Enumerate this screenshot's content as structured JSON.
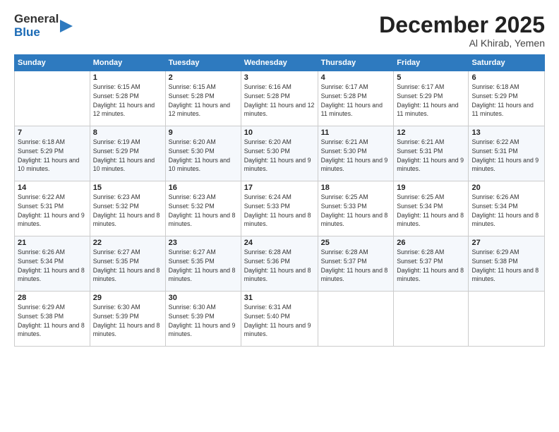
{
  "logo": {
    "general": "General",
    "blue": "Blue"
  },
  "header": {
    "month": "December 2025",
    "location": "Al Khirab, Yemen"
  },
  "weekdays": [
    "Sunday",
    "Monday",
    "Tuesday",
    "Wednesday",
    "Thursday",
    "Friday",
    "Saturday"
  ],
  "weeks": [
    [
      {
        "day": "",
        "info": ""
      },
      {
        "day": "1",
        "info": "Sunrise: 6:15 AM\nSunset: 5:28 PM\nDaylight: 11 hours and 12 minutes."
      },
      {
        "day": "2",
        "info": "Sunrise: 6:15 AM\nSunset: 5:28 PM\nDaylight: 11 hours and 12 minutes."
      },
      {
        "day": "3",
        "info": "Sunrise: 6:16 AM\nSunset: 5:28 PM\nDaylight: 11 hours and 12 minutes."
      },
      {
        "day": "4",
        "info": "Sunrise: 6:17 AM\nSunset: 5:28 PM\nDaylight: 11 hours and 11 minutes."
      },
      {
        "day": "5",
        "info": "Sunrise: 6:17 AM\nSunset: 5:29 PM\nDaylight: 11 hours and 11 minutes."
      },
      {
        "day": "6",
        "info": "Sunrise: 6:18 AM\nSunset: 5:29 PM\nDaylight: 11 hours and 11 minutes."
      }
    ],
    [
      {
        "day": "7",
        "info": "Sunrise: 6:18 AM\nSunset: 5:29 PM\nDaylight: 11 hours and 10 minutes."
      },
      {
        "day": "8",
        "info": "Sunrise: 6:19 AM\nSunset: 5:29 PM\nDaylight: 11 hours and 10 minutes."
      },
      {
        "day": "9",
        "info": "Sunrise: 6:20 AM\nSunset: 5:30 PM\nDaylight: 11 hours and 10 minutes."
      },
      {
        "day": "10",
        "info": "Sunrise: 6:20 AM\nSunset: 5:30 PM\nDaylight: 11 hours and 9 minutes."
      },
      {
        "day": "11",
        "info": "Sunrise: 6:21 AM\nSunset: 5:30 PM\nDaylight: 11 hours and 9 minutes."
      },
      {
        "day": "12",
        "info": "Sunrise: 6:21 AM\nSunset: 5:31 PM\nDaylight: 11 hours and 9 minutes."
      },
      {
        "day": "13",
        "info": "Sunrise: 6:22 AM\nSunset: 5:31 PM\nDaylight: 11 hours and 9 minutes."
      }
    ],
    [
      {
        "day": "14",
        "info": "Sunrise: 6:22 AM\nSunset: 5:31 PM\nDaylight: 11 hours and 9 minutes."
      },
      {
        "day": "15",
        "info": "Sunrise: 6:23 AM\nSunset: 5:32 PM\nDaylight: 11 hours and 8 minutes."
      },
      {
        "day": "16",
        "info": "Sunrise: 6:23 AM\nSunset: 5:32 PM\nDaylight: 11 hours and 8 minutes."
      },
      {
        "day": "17",
        "info": "Sunrise: 6:24 AM\nSunset: 5:33 PM\nDaylight: 11 hours and 8 minutes."
      },
      {
        "day": "18",
        "info": "Sunrise: 6:25 AM\nSunset: 5:33 PM\nDaylight: 11 hours and 8 minutes."
      },
      {
        "day": "19",
        "info": "Sunrise: 6:25 AM\nSunset: 5:34 PM\nDaylight: 11 hours and 8 minutes."
      },
      {
        "day": "20",
        "info": "Sunrise: 6:26 AM\nSunset: 5:34 PM\nDaylight: 11 hours and 8 minutes."
      }
    ],
    [
      {
        "day": "21",
        "info": "Sunrise: 6:26 AM\nSunset: 5:34 PM\nDaylight: 11 hours and 8 minutes."
      },
      {
        "day": "22",
        "info": "Sunrise: 6:27 AM\nSunset: 5:35 PM\nDaylight: 11 hours and 8 minutes."
      },
      {
        "day": "23",
        "info": "Sunrise: 6:27 AM\nSunset: 5:35 PM\nDaylight: 11 hours and 8 minutes."
      },
      {
        "day": "24",
        "info": "Sunrise: 6:28 AM\nSunset: 5:36 PM\nDaylight: 11 hours and 8 minutes."
      },
      {
        "day": "25",
        "info": "Sunrise: 6:28 AM\nSunset: 5:37 PM\nDaylight: 11 hours and 8 minutes."
      },
      {
        "day": "26",
        "info": "Sunrise: 6:28 AM\nSunset: 5:37 PM\nDaylight: 11 hours and 8 minutes."
      },
      {
        "day": "27",
        "info": "Sunrise: 6:29 AM\nSunset: 5:38 PM\nDaylight: 11 hours and 8 minutes."
      }
    ],
    [
      {
        "day": "28",
        "info": "Sunrise: 6:29 AM\nSunset: 5:38 PM\nDaylight: 11 hours and 8 minutes."
      },
      {
        "day": "29",
        "info": "Sunrise: 6:30 AM\nSunset: 5:39 PM\nDaylight: 11 hours and 8 minutes."
      },
      {
        "day": "30",
        "info": "Sunrise: 6:30 AM\nSunset: 5:39 PM\nDaylight: 11 hours and 9 minutes."
      },
      {
        "day": "31",
        "info": "Sunrise: 6:31 AM\nSunset: 5:40 PM\nDaylight: 11 hours and 9 minutes."
      },
      {
        "day": "",
        "info": ""
      },
      {
        "day": "",
        "info": ""
      },
      {
        "day": "",
        "info": ""
      }
    ]
  ]
}
